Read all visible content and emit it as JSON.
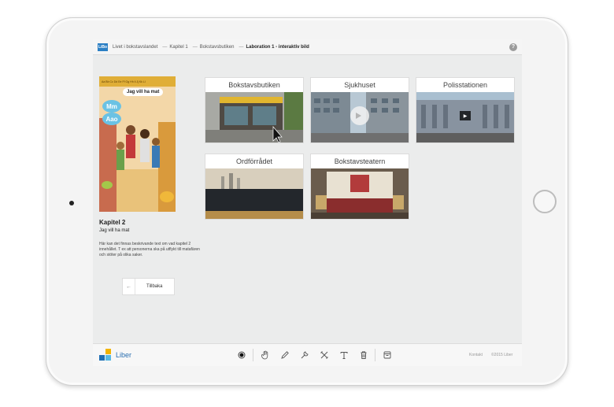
{
  "breadcrumb": {
    "logo_text": "LiBo",
    "items": [
      "Livet i bokstavslandet",
      "Kapitel 1",
      "Bokstavsbutiken"
    ],
    "separator": "—",
    "current": "Laboration 1 - interaktiv bild",
    "help": "?"
  },
  "chapter": {
    "cover_speech": "Jag vill ha mat",
    "cover_mm_1": "Mm",
    "cover_mm_2": "Aao",
    "title": "Kapitel 2",
    "subtitle": "Jag vill ha mat",
    "description": "Här kan det finnas beskrivande text om vad kapitel 2 innehållet. T ex att personerna ska på utflykt till matafären och stöter på olika saker.",
    "back_label": "Tillbaka",
    "back_icon": "arrow-left-icon"
  },
  "cards": [
    {
      "title": "Bokstavsbutiken",
      "selected": true
    },
    {
      "title": "Sjukhuset"
    },
    {
      "title": "Polisstationen"
    },
    {
      "title": "Ordförrådet"
    },
    {
      "title": "Bokstavsteatern"
    }
  ],
  "toolbar": {
    "brand": "Liber",
    "tools": [
      "record-icon",
      "hand-icon",
      "pencil-icon",
      "wrench-icon",
      "tools-icon",
      "text-icon",
      "trash-icon",
      "archive-icon"
    ],
    "contact": "Kontakt",
    "copyright": "©2015 Liber"
  },
  "colors": {
    "accent": "#2b7fc4",
    "liber_yellow": "#f2b400",
    "liber_blue": "#1f6fb5",
    "screen_bg": "#ebecec"
  }
}
